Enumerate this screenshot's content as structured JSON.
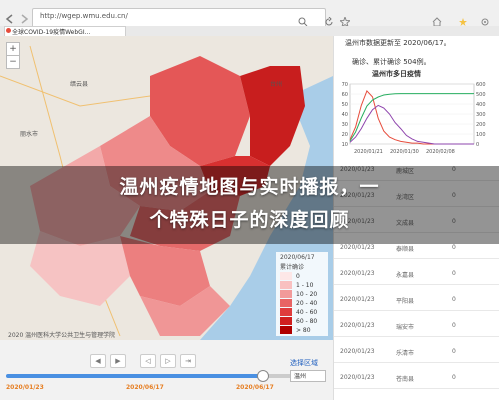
{
  "browser": {
    "url": "http://wgep.wmu.edu.cn/",
    "tab_title": "全球COVID-19疫情WebGI..."
  },
  "panel": {
    "title": "温州市数据更新至 2020/06/17。",
    "subtitle": "确诊、累计确诊 504例。",
    "chart_title": "温州市多日疫情",
    "chart_left_ticks": [
      "70",
      "60",
      "50",
      "40",
      "30",
      "20",
      "10"
    ],
    "chart_right_ticks": [
      "600",
      "500",
      "400",
      "300",
      "200",
      "100",
      "0"
    ],
    "chart_dates": [
      "2020/01/21",
      "2020/01/30",
      "2020/02/08"
    ]
  },
  "chart_data": {
    "type": "line",
    "title": "温州市多日疫情",
    "x_labels": [
      "2020/01/21",
      "2020/01/30",
      "2020/02/08"
    ],
    "ylim_left": [
      0,
      70
    ],
    "ylim_right": [
      0,
      600
    ],
    "series": [
      {
        "color": "#e74c3c",
        "values": [
          5,
          20,
          45,
          62,
          55,
          30,
          15,
          8,
          5,
          3,
          2,
          1,
          1,
          0,
          0,
          0,
          0,
          0,
          0,
          0,
          0,
          0,
          0
        ]
      },
      {
        "color": "#27ae60",
        "values": [
          30,
          120,
          260,
          380,
          440,
          470,
          490,
          498,
          502,
          504,
          504,
          504,
          504,
          504,
          504,
          504,
          504,
          504,
          504,
          504,
          504,
          504,
          504
        ]
      },
      {
        "color": "#8e44ad",
        "values": [
          2,
          8,
          18,
          30,
          40,
          45,
          42,
          35,
          25,
          18,
          10,
          6,
          3,
          2,
          1,
          0,
          0,
          0,
          0,
          0,
          0,
          0,
          0
        ]
      }
    ]
  },
  "table": {
    "rows": [
      {
        "date": "2020/01/23",
        "place": "鹿城区",
        "value": "0"
      },
      {
        "date": "2020/01/23",
        "place": "龙湾区",
        "value": "0"
      },
      {
        "date": "2020/01/23",
        "place": "文成县",
        "value": "0"
      },
      {
        "date": "2020/01/23",
        "place": "泰顺县",
        "value": "0"
      },
      {
        "date": "2020/01/23",
        "place": "永嘉县",
        "value": "0"
      },
      {
        "date": "2020/01/23",
        "place": "平阳县",
        "value": "0"
      },
      {
        "date": "2020/01/23",
        "place": "瑞安市",
        "value": "0"
      },
      {
        "date": "2020/01/23",
        "place": "乐清市",
        "value": "0"
      },
      {
        "date": "2020/01/23",
        "place": "苍南县",
        "value": "0"
      }
    ]
  },
  "legend": {
    "title": "2020/06/17",
    "subtitle": "累计确诊",
    "items": [
      {
        "label": "0",
        "color": "#fde7e7"
      },
      {
        "label": "1 - 10",
        "color": "#f9c0c0"
      },
      {
        "label": "10 - 20",
        "color": "#f29a9a"
      },
      {
        "label": "20 - 40",
        "color": "#e86464"
      },
      {
        "label": "40 - 60",
        "color": "#df3c3c"
      },
      {
        "label": "60 - 80",
        "color": "#d01f1f"
      },
      {
        "label": "> 80",
        "color": "#b00000"
      }
    ]
  },
  "map": {
    "attribution": "2020 温州医科大学公共卫生与管理学院"
  },
  "timeline": {
    "start_date": "2020/01/23",
    "mid_date": "2020/06/17",
    "end_date": "2020/06/17",
    "progress": 0.8,
    "select_label": "选择区域",
    "select_value": "温州"
  },
  "banner": {
    "line1": "温州疫情地图与实时播报，一",
    "line2": "个特殊日子的深度回顾"
  }
}
